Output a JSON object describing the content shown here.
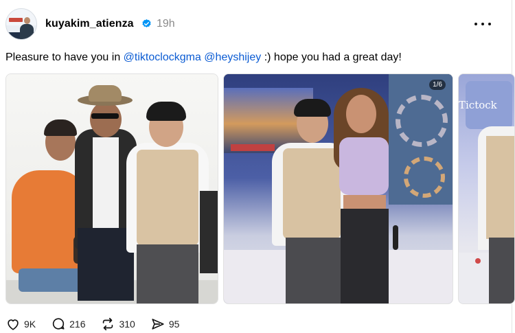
{
  "post": {
    "username": "kuyakim_atienza",
    "time": "19h",
    "caption": {
      "text_before": "Pleasure to have you in ",
      "mention_1": "@tiktoclockgma",
      "between": " ",
      "mention_2": "@heyshijey",
      "text_after": " :) hope you had a great day!"
    },
    "media": {
      "counter": "1/6",
      "photo3_sign": "Tictock"
    },
    "actions": {
      "likes": "9K",
      "replies": "216",
      "reposts": "310",
      "shares": "95"
    }
  },
  "colors": {
    "mention": "#0a5bd3",
    "verified_badge": "#0095f6",
    "muted_text": "#8a8a8a"
  },
  "icons": {
    "more": "more-dots-icon",
    "verified": "verified-badge-icon",
    "like": "heart-icon",
    "reply": "comment-bubble-icon",
    "repost": "repost-arrows-icon",
    "share": "share-arrow-icon"
  }
}
